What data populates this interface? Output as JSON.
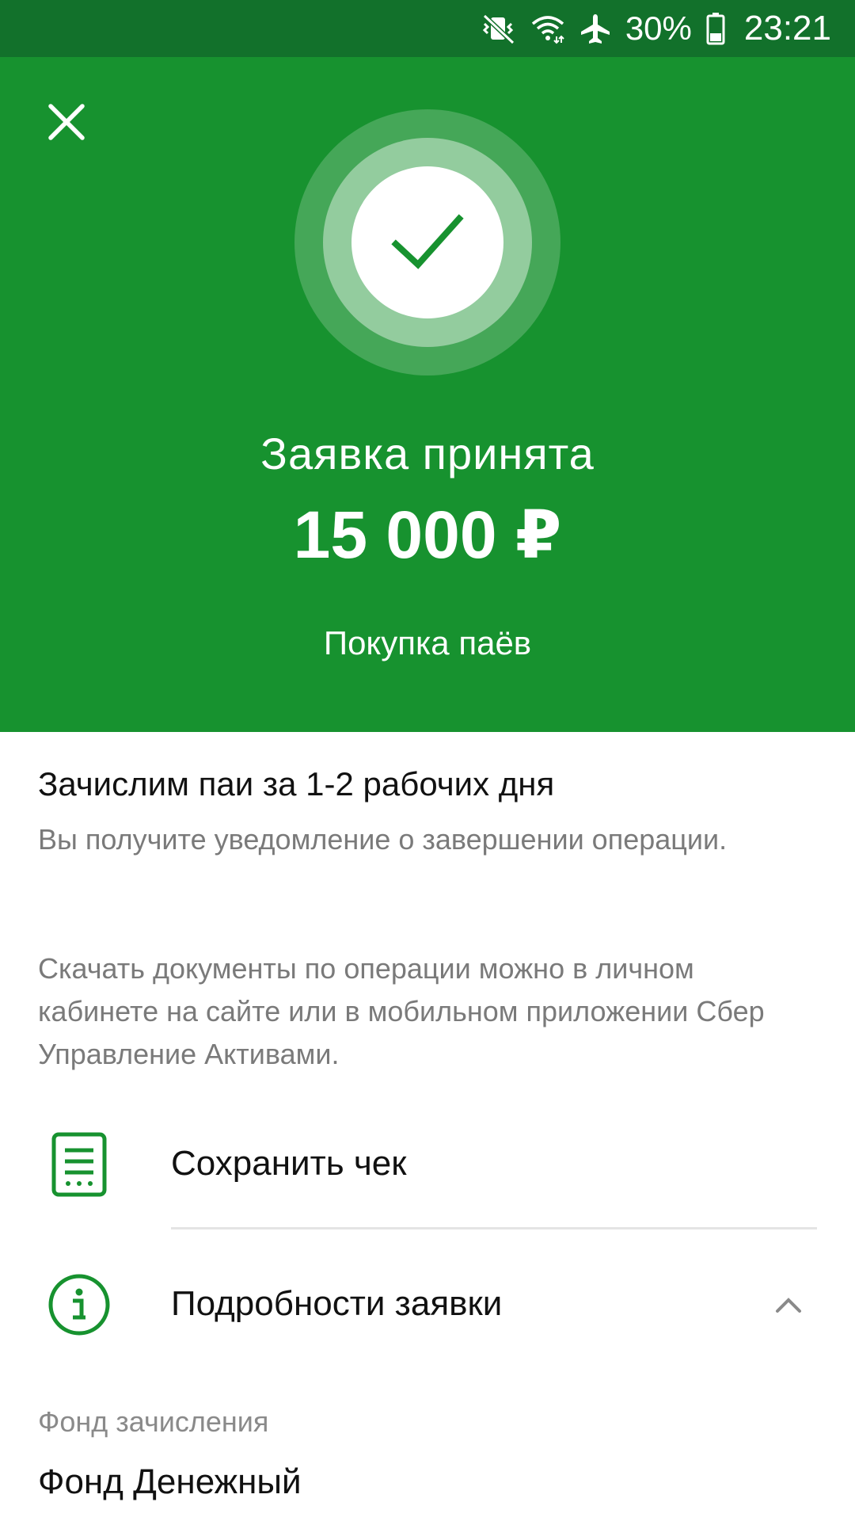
{
  "status_bar": {
    "battery_percent": "30%",
    "time": "23:21",
    "icons": [
      "vibrate-mute-icon",
      "wifi-icon",
      "airplane-icon",
      "battery-icon"
    ]
  },
  "hero": {
    "title": "Заявка принята",
    "amount": "15 000 ₽",
    "subtitle": "Покупка паёв",
    "background_color": "#17922f"
  },
  "info": {
    "title": "Зачислим паи за 1-2 рабочих дня",
    "text1": "Вы получите уведомление о завершении операции.",
    "text2": "Скачать документы по операции можно в личном кабинете на сайте или в мобильном приложении Сбер Управление Активами."
  },
  "actions": {
    "save_receipt": "Сохранить чек",
    "request_details": "Подробности заявки"
  },
  "details": {
    "fund_label": "Фонд зачисления",
    "fund_value": "Фонд Денежный"
  },
  "colors": {
    "accent": "#17922f",
    "status_bar": "#12712b"
  }
}
